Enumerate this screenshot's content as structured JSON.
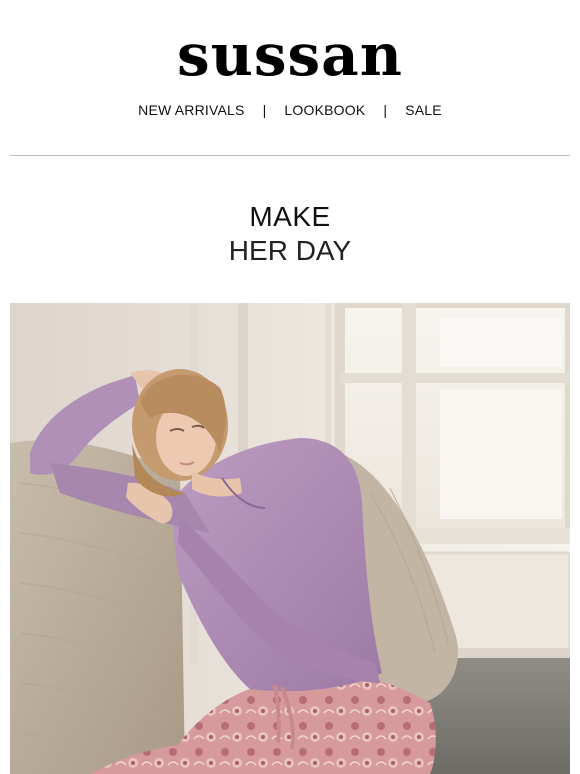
{
  "brand": {
    "logo_text": "sussan"
  },
  "nav": {
    "items": [
      {
        "label": "NEW ARRIVALS"
      },
      {
        "label": "LOOKBOOK"
      },
      {
        "label": "SALE"
      }
    ],
    "separator": "|"
  },
  "hero": {
    "headline_line1": "MAKE",
    "headline_line2": "HER DAY",
    "image_icon": "hero-photo-woman-in-lilac-pyjamas"
  },
  "colors": {
    "background": "#ffffff",
    "text": "#111111",
    "lilac": "#b08ab6",
    "wall": "#e9e2da",
    "blanket": "#b9ac9a"
  }
}
